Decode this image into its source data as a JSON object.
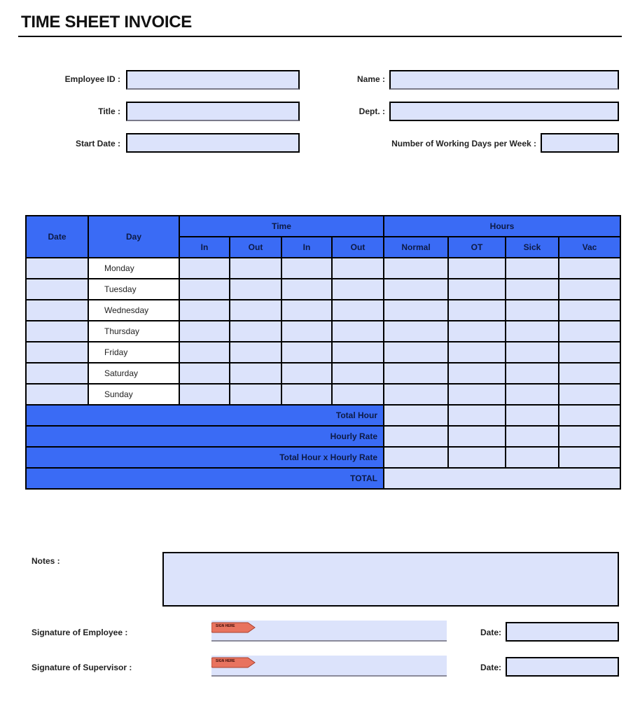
{
  "header": {
    "title": "TIME SHEET INVOICE"
  },
  "employee_info": {
    "employee_id": {
      "label": "Employee ID :",
      "value": ""
    },
    "title": {
      "label": "Title :",
      "value": ""
    },
    "start_date": {
      "label": "Start Date :",
      "value": ""
    },
    "name": {
      "label": "Name :",
      "value": ""
    },
    "dept": {
      "label": "Dept. :",
      "value": ""
    },
    "working_days": {
      "label": "Number of Working Days per Week :",
      "value": ""
    }
  },
  "timesheet": {
    "headers": {
      "date": "Date",
      "day": "Day",
      "time_group": "Time",
      "hours_group": "Hours",
      "time_cols": [
        "In",
        "Out",
        "In",
        "Out"
      ],
      "hours_cols": [
        "Normal",
        "OT",
        "Sick",
        "Vac"
      ]
    },
    "rows": [
      {
        "day": "Monday"
      },
      {
        "day": "Tuesday"
      },
      {
        "day": "Wednesday"
      },
      {
        "day": "Thursday"
      },
      {
        "day": "Friday"
      },
      {
        "day": "Saturday"
      },
      {
        "day": "Sunday"
      }
    ],
    "summary": {
      "total_hour": "Total Hour",
      "hourly_rate": "Hourly Rate",
      "total_x_rate": "Total Hour x Hourly Rate",
      "total": "TOTAL"
    }
  },
  "footer": {
    "notes_label": "Notes :",
    "notes_value": "",
    "sig_employee_label": "Signature of Employee :",
    "sig_supervisor_label": "Signature of Supervisor :",
    "sign_here_tag": "SIGN HERE",
    "date_label": "Date:",
    "sig_tag_color": "#e8735f",
    "accent_color": "#3a6bf5",
    "field_color": "#dce3fb"
  }
}
